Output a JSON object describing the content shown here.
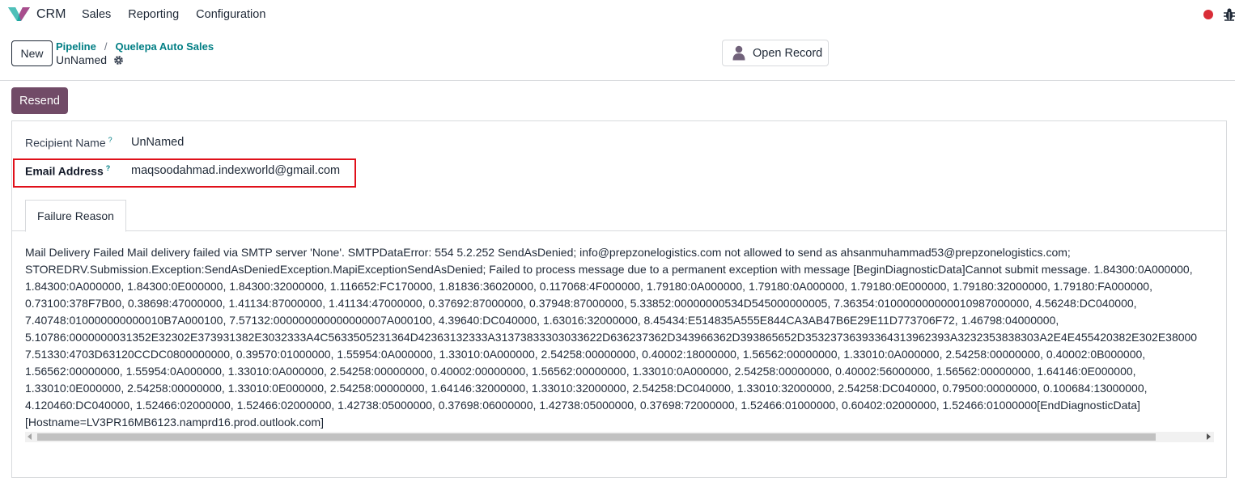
{
  "navbar": {
    "app_name": "CRM",
    "menu": [
      "Sales",
      "Reporting",
      "Configuration"
    ],
    "status_color": "#d92d37"
  },
  "control_panel": {
    "new_label": "New",
    "breadcrumb": [
      "Pipeline",
      "Quelepa Auto Sales"
    ],
    "record_name": "UnNamed",
    "open_record_label": "Open Record"
  },
  "actions": {
    "resend_label": "Resend"
  },
  "form": {
    "recipient_label": "Recipient Name",
    "recipient_value": "UnNamed",
    "email_label": "Email Address",
    "email_value": "maqsoodahmad.indexworld@gmail.com",
    "help_mark": "?"
  },
  "tabs": {
    "active": "Failure Reason"
  },
  "failure_reason": [
    "Mail Delivery Failed Mail delivery failed via SMTP server 'None'. SMTPDataError: 554 5.2.252 SendAsDenied; info@prepzonelogistics.com not allowed to send as ahsanmuhammad53@prepzonelogistics.com;",
    "STOREDRV.Submission.Exception:SendAsDeniedException.MapiExceptionSendAsDenied; Failed to process message due to a permanent exception with message [BeginDiagnosticData]Cannot submit message. 1.84300:0A000000,",
    "1.84300:0A000000, 1.84300:0E000000, 1.84300:32000000, 1.116652:FC170000, 1.81836:36020000, 0.117068:4F000000, 1.79180:0A000000, 1.79180:0A000000, 1.79180:0E000000, 1.79180:32000000, 1.79180:FA000000,",
    "0.73100:378F7B00, 0.38698:47000000, 1.41134:87000000, 1.41134:47000000, 0.37692:87000000, 0.37948:87000000, 5.33852:00000000534D545000000005, 7.36354:010000000000010987000000, 4.56248:DC040000,",
    "7.40748:010000000000010B7A000100, 7.57132:000000000000000007A000100, 4.39640:DC040000, 1.63016:32000000, 8.45434:E514835A555E844CA3AB47B6E29E11D773706F72, 1.46798:04000000,",
    "5.10786:0000000031352E32302E373931382E3032333A4C5633505231364D42363132333A31373833303033622D636237362D343966362D393865652D35323736393364313962393A3232353838303A2E4E455420382E302E38000",
    "7.51330:4703D63120CCDC0800000000, 0.39570:01000000, 1.55954:0A000000, 1.33010:0A000000, 2.54258:00000000, 0.40002:18000000, 1.56562:00000000, 1.33010:0A000000, 2.54258:00000000, 0.40002:0B000000,",
    "1.56562:00000000, 1.55954:0A000000, 1.33010:0A000000, 2.54258:00000000, 0.40002:00000000, 1.56562:00000000, 1.33010:0A000000, 2.54258:00000000, 0.40002:56000000, 1.56562:00000000, 1.64146:0E000000,",
    "1.33010:0E000000, 2.54258:00000000, 1.33010:0E000000, 2.54258:00000000, 1.64146:32000000, 1.33010:32000000, 2.54258:DC040000, 1.33010:32000000, 2.54258:DC040000, 0.79500:00000000, 0.100684:13000000,",
    "4.120460:DC040000, 1.52466:02000000, 1.52466:02000000, 1.42738:05000000, 0.37698:06000000, 1.42738:05000000, 0.37698:72000000, 1.52466:01000000, 0.60402:02000000, 1.52466:01000000[EndDiagnosticData]",
    "[Hostname=LV3PR16MB6123.namprd16.prod.outlook.com]"
  ]
}
